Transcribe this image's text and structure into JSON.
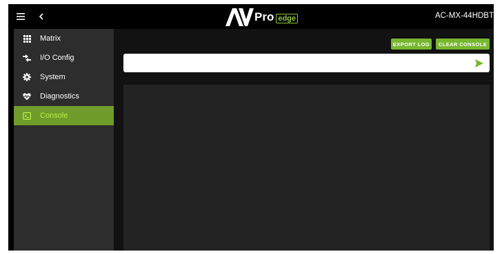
{
  "header": {
    "logo_text": "Pro",
    "logo_badge": "edge",
    "device_name": "AC-MX-44HDBT"
  },
  "sidebar": {
    "items": [
      {
        "label": "Matrix",
        "icon": "grid-icon"
      },
      {
        "label": "I/O Config",
        "icon": "swap-arrows-icon"
      },
      {
        "label": "System",
        "icon": "gear-icon"
      },
      {
        "label": "Diagnostics",
        "icon": "heart-pulse-icon"
      },
      {
        "label": "Console",
        "icon": "terminal-icon",
        "active": true
      }
    ]
  },
  "toolbar": {
    "export_label": "EXPORT LOG",
    "clear_label": "CLEAR CONSOLE"
  },
  "command": {
    "value": ""
  },
  "colors": {
    "accent": "#77b72f",
    "sidebar_bg": "#2d2d2d",
    "active_item": "#6f9c2a",
    "console_bg": "#232323"
  }
}
